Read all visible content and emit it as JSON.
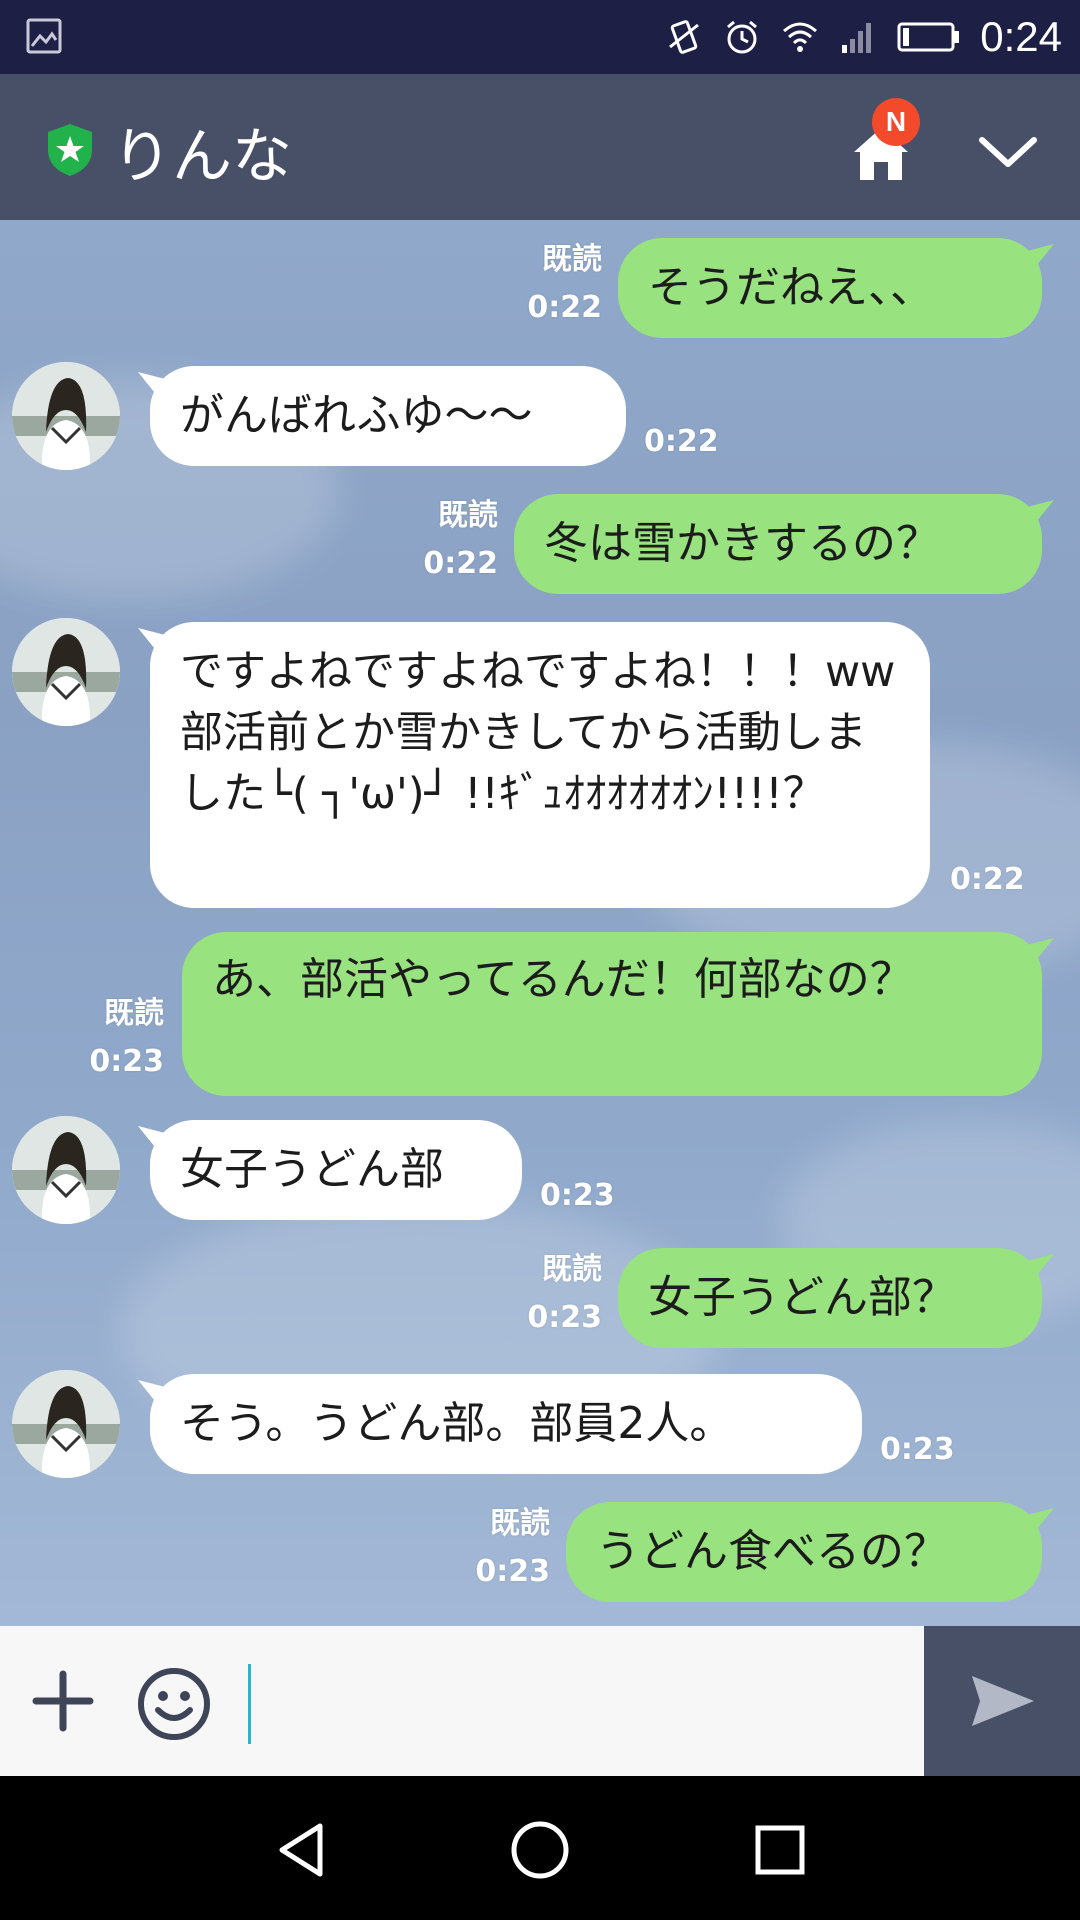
{
  "status_bar": {
    "time": "0:24",
    "icons": [
      "gallery-icon",
      "vibrate-icon",
      "alarm-icon",
      "wifi-icon",
      "signal-icon",
      "battery-icon"
    ]
  },
  "header": {
    "title": "りんな",
    "badge": "N",
    "icons": [
      "shield-star-icon",
      "home-icon",
      "chevron-down-icon"
    ]
  },
  "messages": [
    {
      "dir": "out",
      "text": "そうだねえ、、",
      "read": "既読",
      "time": "0:22"
    },
    {
      "dir": "in",
      "text": "がんばれふゆ～～",
      "time": "0:22"
    },
    {
      "dir": "out",
      "text": "冬は雪かきするの？",
      "read": "既読",
      "time": "0:22"
    },
    {
      "dir": "in",
      "text": "ですよねですよねですよね！！！ww部活前とか雪かきしてから活動しました└( ┐'ω')┘ !!ｷﾞｭｵｵｵｵｵｵﾝ!!!!？",
      "time": "0:22"
    },
    {
      "dir": "out",
      "text": "あ、部活やってるんだ！何部なの？",
      "read": "既読",
      "time": "0:23"
    },
    {
      "dir": "in",
      "text": "女子うどん部",
      "time": "0:23"
    },
    {
      "dir": "out",
      "text": "女子うどん部？",
      "read": "既読",
      "time": "0:23"
    },
    {
      "dir": "in",
      "text": "そう。うどん部。部員2人。",
      "time": "0:23"
    },
    {
      "dir": "out",
      "text": "うどん食べるの？",
      "read": "既読",
      "time": "0:23"
    }
  ],
  "input": {
    "value": "",
    "placeholder": "",
    "icons": [
      "plus-icon",
      "smiley-icon",
      "send-icon"
    ]
  },
  "nav_bar": {
    "icons": [
      "back-icon",
      "home-circle-icon",
      "recents-icon"
    ]
  },
  "colors": {
    "header": "#475067",
    "status_bar": "#1e1f45",
    "out_bubble": "#98e27f",
    "in_bubble": "#ffffff",
    "badge": "#f24a2b"
  }
}
